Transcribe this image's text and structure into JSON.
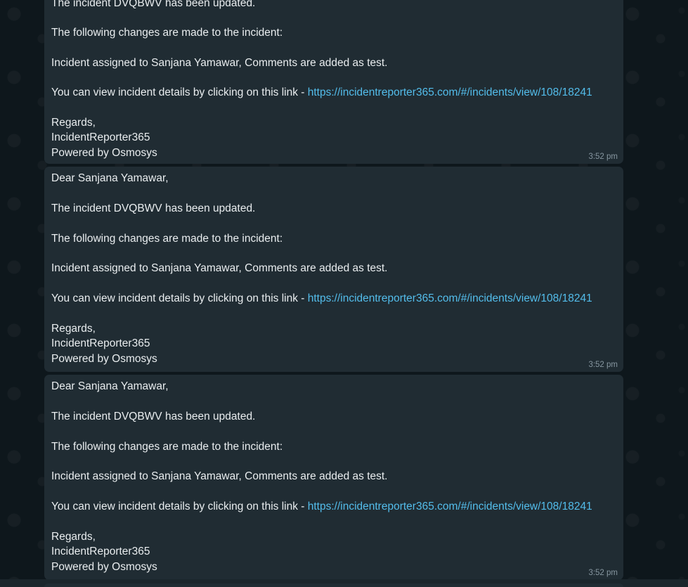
{
  "messages": [
    {
      "lines": {
        "updated": "The incident DVQBWV has been updated.",
        "changes": "The following changes are made to the incident:",
        "assigned": "Incident assigned to  Sanjana Yamawar, Comments are added as test.",
        "view_prefix": "You can view incident details by clicking on this link - ",
        "link": "https://incidentreporter365.com/#/incidents/view/108/18241",
        "regards": "Regards,",
        "reporter": "IncidentReporter365",
        "powered": "Powered by Osmosys"
      },
      "time": "3:52 pm"
    },
    {
      "lines": {
        "greeting": "Dear Sanjana Yamawar,",
        "updated": "The incident DVQBWV has been updated.",
        "changes": "The following changes are made to the incident:",
        "assigned": "Incident assigned to  Sanjana Yamawar, Comments are added as test.",
        "view_prefix": "You can view incident details by clicking on this link - ",
        "link": "https://incidentreporter365.com/#/incidents/view/108/18241",
        "regards": "Regards,",
        "reporter": "IncidentReporter365",
        "powered": "Powered by Osmosys"
      },
      "time": "3:52 pm"
    },
    {
      "lines": {
        "greeting": "Dear Sanjana Yamawar,",
        "updated": "The incident DVQBWV has been updated.",
        "changes": "The following changes are made to the incident:",
        "assigned": "Incident assigned to  Sanjana Yamawar, Comments are added as test.",
        "view_prefix": "You can view incident details by clicking on this link - ",
        "link": "https://incidentreporter365.com/#/incidents/view/108/18241",
        "regards": "Regards,",
        "reporter": "IncidentReporter365",
        "powered": "Powered by Osmosys"
      },
      "time": "3:52 pm"
    }
  ],
  "colors": {
    "bubble": "#202c33",
    "text": "#e9edef",
    "link": "#53bdeb",
    "time": "#8696a0",
    "background": "#0e171c"
  }
}
